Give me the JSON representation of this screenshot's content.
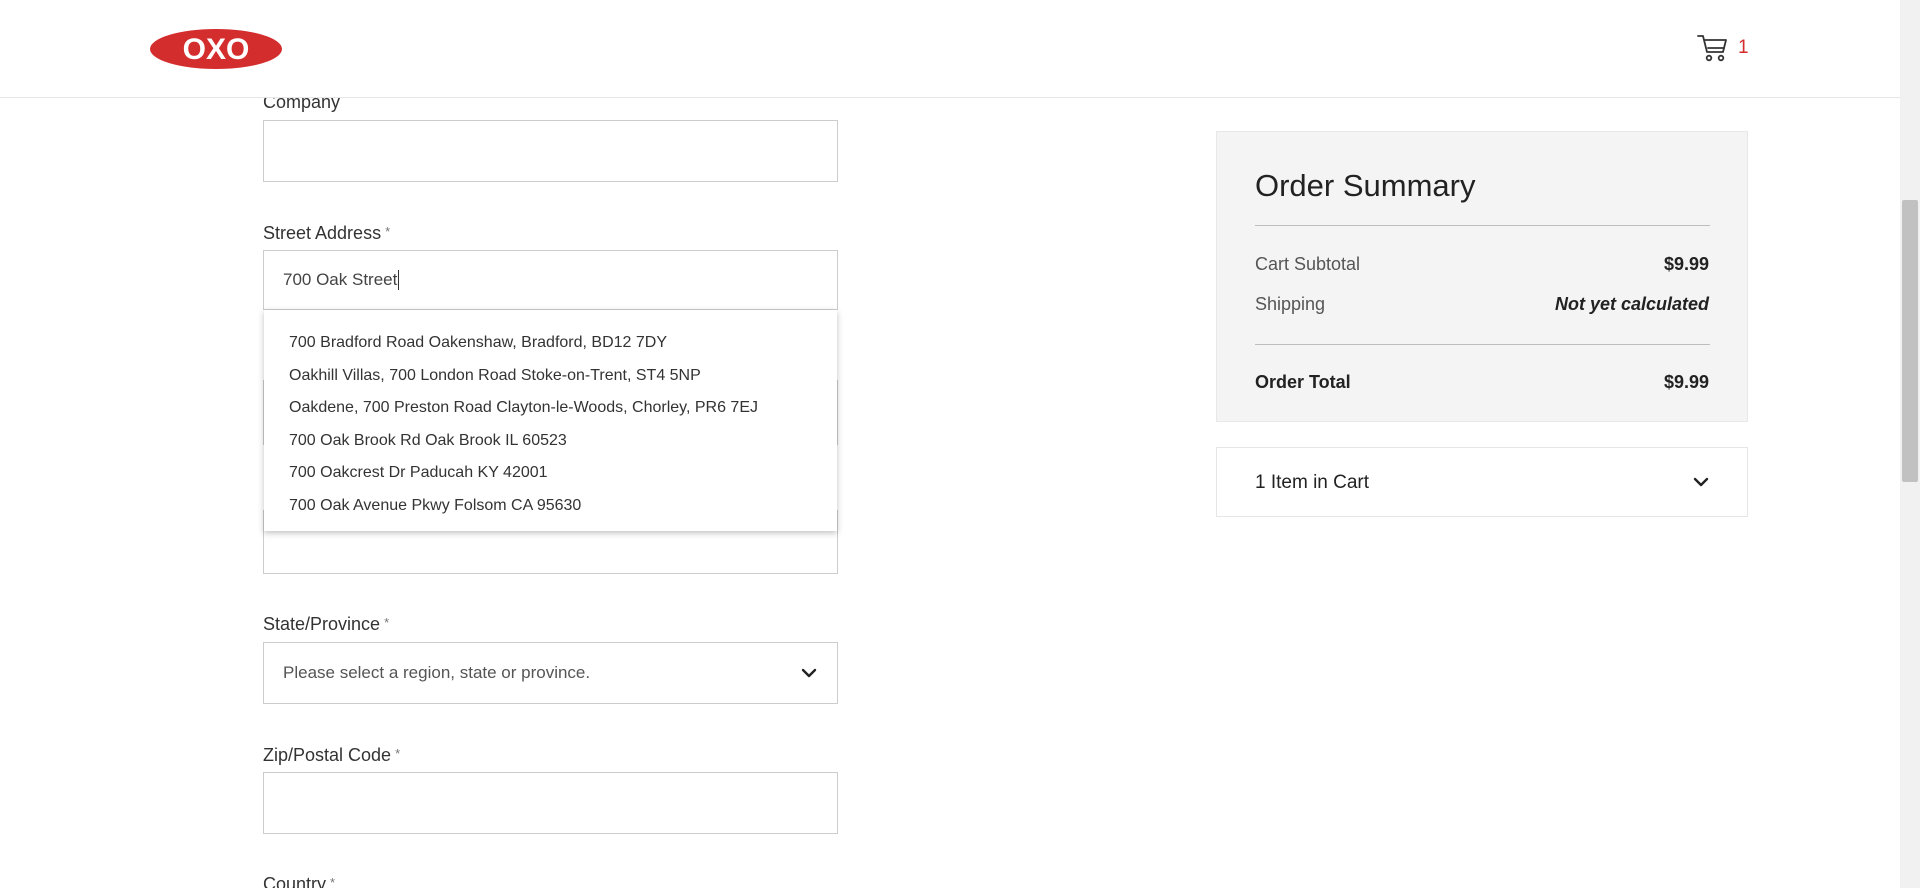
{
  "header": {
    "logo_text": "OXO",
    "cart_count": "1",
    "brand_color": "#d32d2d"
  },
  "form": {
    "company": {
      "label": "Company",
      "value": ""
    },
    "street": {
      "label": "Street Address",
      "required": "*",
      "value": "700 Oak Street"
    },
    "state": {
      "label": "State/Province",
      "required": "*",
      "placeholder": "Please select a region, state or province."
    },
    "zip": {
      "label": "Zip/Postal Code",
      "required": "*",
      "value": ""
    },
    "country": {
      "label": "Country",
      "required": "*"
    }
  },
  "autocomplete": {
    "suggestions": [
      "700 Bradford Road Oakenshaw, Bradford, BD12 7DY",
      "Oakhill Villas, 700 London Road Stoke-on-Trent, ST4 5NP",
      "Oakdene, 700 Preston Road Clayton-le-Woods, Chorley, PR6 7EJ",
      "700 Oak Brook Rd Oak Brook IL 60523",
      "700 Oakcrest Dr Paducah KY 42001",
      "700 Oak Avenue Pkwy Folsom CA 95630"
    ]
  },
  "summary": {
    "title": "Order Summary",
    "subtotal_label": "Cart Subtotal",
    "subtotal_value": "$9.99",
    "shipping_label": "Shipping",
    "shipping_value": "Not yet calculated",
    "total_label": "Order Total",
    "total_value": "$9.99",
    "items_label": "1 Item in Cart"
  },
  "icons": {
    "cart": "cart-icon",
    "chevron": "chevron-down-icon"
  }
}
